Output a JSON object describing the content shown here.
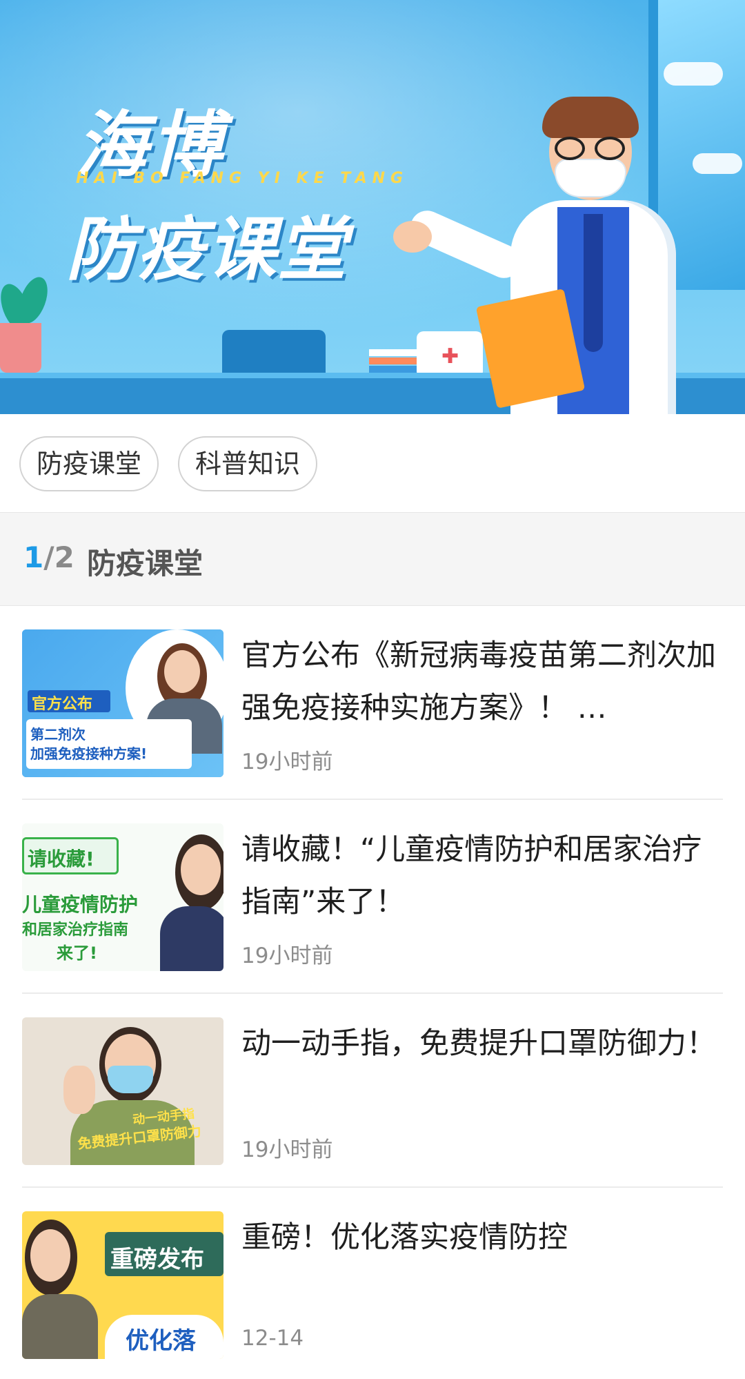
{
  "banner": {
    "title_line1": "海博",
    "pinyin": "HAI BO FANG YI KE TANG",
    "title_line2": "防疫课堂"
  },
  "categories": [
    {
      "label": "防疫课堂"
    },
    {
      "label": "科普知识"
    }
  ],
  "section": {
    "page_current": "1",
    "page_total": "/2",
    "title": "防疫课堂"
  },
  "articles": [
    {
      "title": "官方公布《新冠病毒疫苗第二剂次加强免疫接种实施方案》！ …",
      "time": "19小时前",
      "thumb_text": [
        "官方公布",
        "第二剂次",
        "加强免疫接种方案!"
      ]
    },
    {
      "title": "请收藏！“儿童疫情防护和居家治疗指南”来了！",
      "time": "19小时前",
      "thumb_text": [
        "请收藏!",
        "儿童疫情防护",
        "和居家治疗指南",
        "来了!"
      ]
    },
    {
      "title": "动一动手指，免费提升口罩防御力！",
      "time": "19小时前",
      "thumb_text": [
        "动一动手指",
        "免费提升口罩防御力"
      ]
    },
    {
      "title": "重磅！优化落实疫情防控",
      "time": "12-14",
      "thumb_text": [
        "重磅发布",
        "优化落"
      ]
    }
  ],
  "colors": {
    "accent": "#1d9ae6",
    "banner_blue": "#4db3ec",
    "time_gray": "#8c8c8c"
  }
}
